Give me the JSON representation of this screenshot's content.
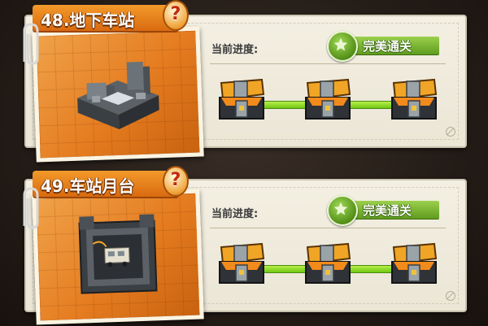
{
  "levels": [
    {
      "title": "48.地下车站",
      "help": "?",
      "progress_label": "当前进度:",
      "status": "完美通关",
      "chests": 3,
      "icon_scene": "underground-station-icon"
    },
    {
      "title": "49.车站月台",
      "help": "?",
      "progress_label": "当前进度:",
      "status": "完美通关",
      "chests": 3,
      "icon_scene": "station-platform-icon"
    }
  ],
  "colors": {
    "tab_orange": "#e8801c",
    "progress_green": "#8fdc2a",
    "badge_green": "#5f9c20",
    "card_bg": "#efebdc"
  },
  "icons": {
    "help": "question-mark-icon",
    "star": "star-icon",
    "chest": "treasure-chest-open-icon",
    "clip": "paperclip-icon",
    "no": "no-sign-icon"
  }
}
